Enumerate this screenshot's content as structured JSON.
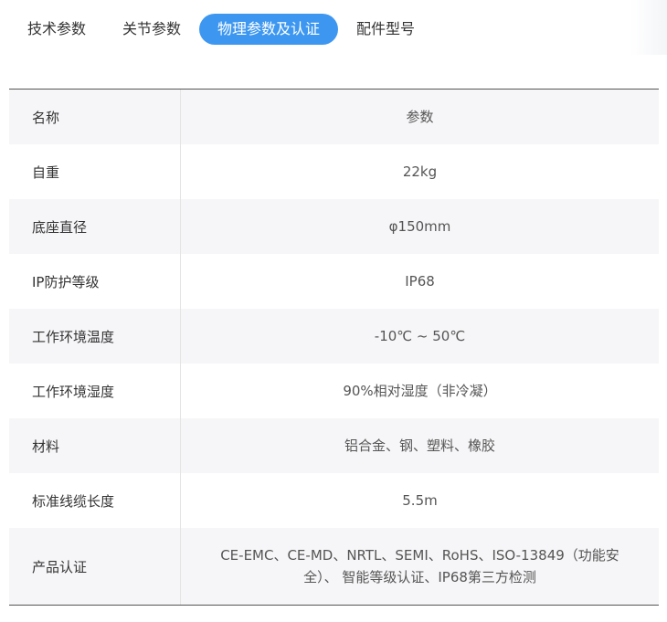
{
  "tabs": [
    {
      "label": "技术参数",
      "active": false
    },
    {
      "label": "关节参数",
      "active": false
    },
    {
      "label": "物理参数及认证",
      "active": true
    },
    {
      "label": "配件型号",
      "active": false
    }
  ],
  "colors": {
    "accent": "#3d97f0",
    "row_shade": "#f6f6f8",
    "text": "#333333"
  },
  "table": {
    "header": {
      "name": "名称",
      "value": "参数"
    },
    "rows": [
      {
        "name": "自重",
        "value": "22kg"
      },
      {
        "name": "底座直径",
        "value": "φ150mm"
      },
      {
        "name": "IP防护等级",
        "value": "IP68"
      },
      {
        "name": "工作环境温度",
        "value": "-10℃ ~ 50℃"
      },
      {
        "name": "工作环境湿度",
        "value": "90%相对湿度（非冷凝）"
      },
      {
        "name": "材料",
        "value": "铝合金、钢、塑料、橡胶"
      },
      {
        "name": "标准线缆长度",
        "value": "5.5m"
      },
      {
        "name": "产品认证",
        "value": "CE-EMC、CE-MD、NRTL、SEMI、RoHS、ISO-13849（功能安全）、 智能等级认证、IP68第三方检测"
      }
    ]
  }
}
